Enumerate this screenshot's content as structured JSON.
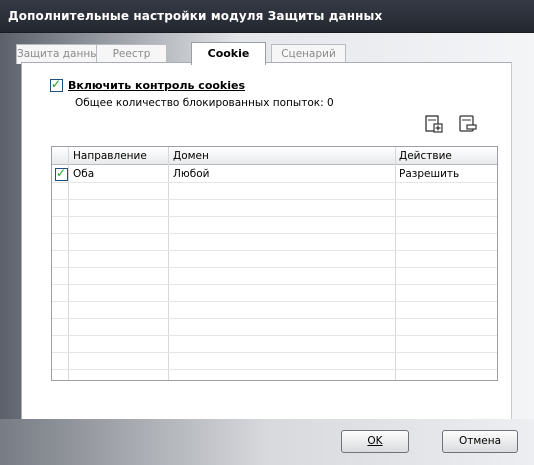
{
  "window": {
    "title": "Дополнительные настройки модуля Защиты данных"
  },
  "tabs": [
    {
      "label": "Защита данных",
      "active": false
    },
    {
      "label": "Реестр",
      "active": false
    },
    {
      "label": "Cookie",
      "active": true
    },
    {
      "label": "Сценарий",
      "active": false
    }
  ],
  "cookie": {
    "enable_label": "Включить контроль cookies",
    "enabled": true,
    "blocked_info": "Общее количество блокированных попыток: 0"
  },
  "toolbar": {
    "add_icon": "add-rule-icon",
    "edit_icon": "edit-rule-icon"
  },
  "grid": {
    "columns": [
      "Направление",
      "Домен",
      "Действие"
    ],
    "rows": [
      {
        "checked": true,
        "direction": "Оба",
        "domain": "Любой",
        "action": "Разрешить"
      }
    ]
  },
  "buttons": {
    "ok": "OK",
    "cancel": "Отмена"
  },
  "colors": {
    "titlebar": "#2c313b",
    "check": "#21a121"
  }
}
